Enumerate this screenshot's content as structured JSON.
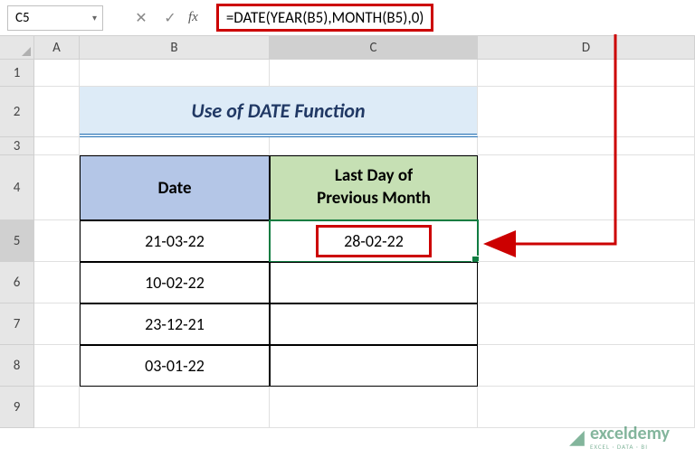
{
  "nameBox": "C5",
  "formula": "=DATE(YEAR(B5),MONTH(B5),0)",
  "columns": [
    "A",
    "B",
    "C",
    "D"
  ],
  "rows": [
    "1",
    "2",
    "3",
    "4",
    "5",
    "6",
    "7",
    "8",
    "9"
  ],
  "title": "Use of DATE Function",
  "headers": {
    "date": "Date",
    "lastDayLine1": "Last Day of",
    "lastDayLine2": "Previous Month"
  },
  "tableData": [
    {
      "date": "21-03-22",
      "result": "28-02-22"
    },
    {
      "date": "10-02-22",
      "result": ""
    },
    {
      "date": "23-12-21",
      "result": ""
    },
    {
      "date": "03-01-22",
      "result": ""
    }
  ],
  "watermark": {
    "name": "exceldemy",
    "tagline": "EXCEL · DATA · BI"
  }
}
